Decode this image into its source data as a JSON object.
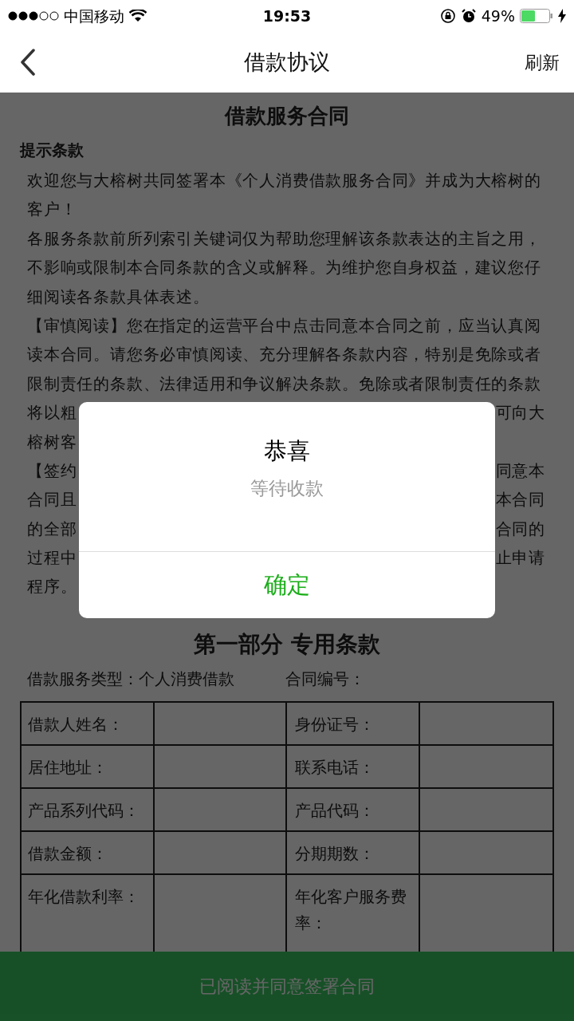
{
  "status_bar": {
    "carrier": "中国移动",
    "time": "19:53",
    "battery": "49%"
  },
  "nav": {
    "title": "借款协议",
    "action": "刷新"
  },
  "document": {
    "title": "借款服务合同",
    "section_heading": "提示条款",
    "lines": [
      {
        "kind": "full",
        "text": "欢迎您与大榕树共同签署本《个人消费借款服务合同》并成为大榕树的"
      },
      {
        "kind": "full",
        "text": "客户！"
      },
      {
        "kind": "full",
        "text": "各服务条款前所列索引关键词仅为帮助您理解该条款表达的主旨之用，"
      },
      {
        "kind": "full",
        "text": "不影响或限制本合同条款的含义或解释。为维护您自身权益，建议您仔"
      },
      {
        "kind": "full",
        "text": "细阅读各条款具体表述。"
      },
      {
        "kind": "full",
        "text": "【审慎阅读】您在指定的运营平台中点击同意本合同之前，应当认真阅"
      },
      {
        "kind": "full",
        "text": "读本合同。请您务必审慎阅读、充分理解各条款内容，特别是免除或者"
      },
      {
        "kind": "full",
        "text": "限制责任的条款、法律适用和争议解决条款。免除或者限制责任的条款"
      },
      {
        "kind": "split",
        "left": "将以粗",
        "right": "可向大"
      },
      {
        "kind": "split",
        "left": "榕树客"
      },
      {
        "kind": "split",
        "left": "【签约",
        "right": "同意本"
      },
      {
        "kind": "split",
        "left": "合同且",
        "right": "本合同"
      },
      {
        "kind": "split",
        "left": "的全部",
        "right": "合同的"
      },
      {
        "kind": "split",
        "left": "过程中",
        "right": "止申请"
      },
      {
        "kind": "full",
        "text": "程序。"
      }
    ],
    "part_title": "第一部分 专用条款",
    "type_label": "借款服务类型：",
    "type_value": "个人消费借款",
    "contract_no_label": "合同编号：",
    "table_rows": [
      {
        "label_1": "借款人姓名：",
        "label_2": "身份证号："
      },
      {
        "label_1": "居住地址：",
        "label_2": "联系电话："
      },
      {
        "label_1": "产品系列代码：",
        "label_2": "产品代码："
      },
      {
        "label_1": "借款金额：",
        "label_2": "分期期数："
      },
      {
        "label_1": "年化借款利率：",
        "label_2": "年化客户服务费率："
      }
    ]
  },
  "dialog": {
    "title": "恭喜",
    "message": "等待收款",
    "button": "确定"
  },
  "bottom_button": "已阅读并同意签署合同"
}
